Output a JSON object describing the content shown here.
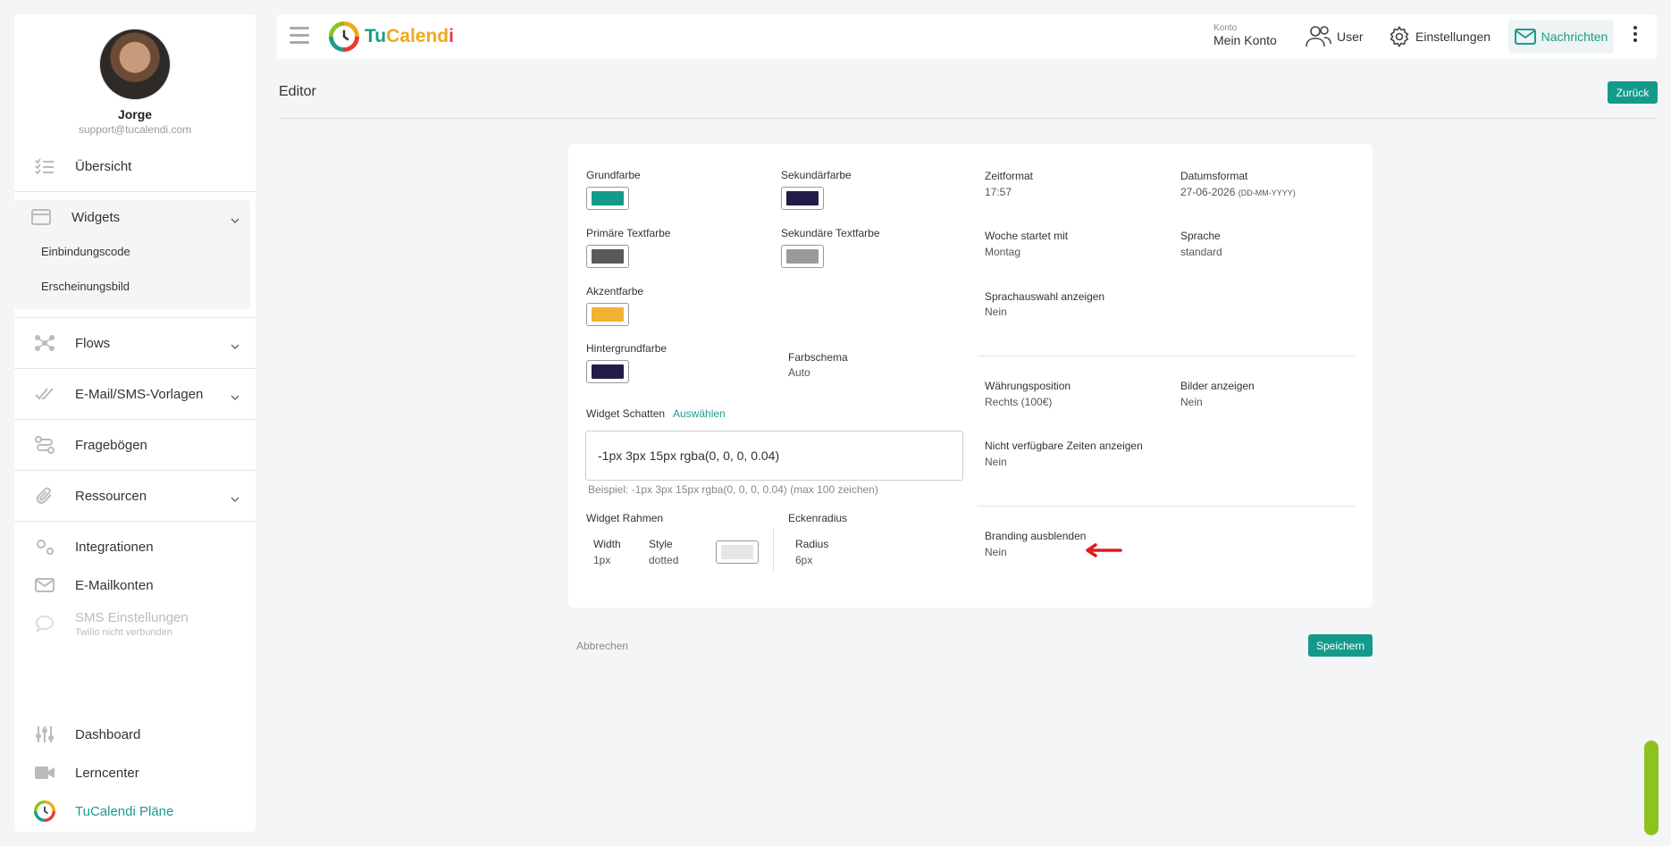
{
  "profile": {
    "name": "Jorge",
    "email": "support@tucalendi.com"
  },
  "sidebar": {
    "overview": "Übersicht",
    "widgets": "Widgets",
    "widgets_sub": [
      "Einbindungscode",
      "Erscheinungsbild"
    ],
    "flows": "Flows",
    "templates": "E-Mail/SMS-Vorlagen",
    "forms": "Fragebögen",
    "resources": "Ressourcen",
    "integrations": "Integrationen",
    "mail_accounts": "E-Mailkonten",
    "sms": "SMS Einstellungen",
    "sms_sub": "Twilio nicht verbunden",
    "dashboard": "Dashboard",
    "learn": "Lerncenter",
    "plans": "TuCalendi Pläne"
  },
  "topbar": {
    "logo_a": "Tu",
    "logo_b": "Calend",
    "logo_c": "i",
    "konto_small": "Konto",
    "konto_big": "Mein Konto",
    "user": "User",
    "settings": "Einstellungen",
    "messages": "Nachrichten"
  },
  "page": {
    "title": "Editor",
    "back": "Zurück",
    "cancel": "Abbrechen",
    "save": "Speichern"
  },
  "colors": {
    "primary": {
      "label": "Grundfarbe",
      "value": "#149a8a"
    },
    "secondary": {
      "label": "Sekundärfarbe",
      "value": "#221c4a"
    },
    "text_primary": {
      "label": "Primäre Textfarbe",
      "value": "#5a5a5a"
    },
    "text_secondary": {
      "label": "Sekundäre Textfarbe",
      "value": "#9a9a9a"
    },
    "accent": {
      "label": "Akzentfarbe",
      "value": "#f2b133"
    },
    "background": {
      "label": "Hintergrundfarbe",
      "value": "#221c4a"
    },
    "border": {
      "value": "#e6e6e6"
    }
  },
  "scheme": {
    "label": "Farbschema",
    "value": "Auto"
  },
  "shadow": {
    "label": "Widget Schatten",
    "select": "Auswählen",
    "value": "-1px 3px 15px rgba(0, 0, 0, 0.04)",
    "hint": "Beispiel: -1px 3px 15px rgba(0, 0, 0, 0.04) (max 100 zeichen)"
  },
  "border": {
    "label": "Widget Rahmen",
    "width_label": "Width",
    "width_value": "1px",
    "style_label": "Style",
    "style_value": "dotted"
  },
  "radius": {
    "label": "Eckenradius",
    "radius_label": "Radius",
    "radius_value": "6px"
  },
  "settings": {
    "time_format": {
      "label": "Zeitformat",
      "value": "17:57"
    },
    "date_format": {
      "label": "Datumsformat",
      "value": "27-06-2026",
      "hint": "(DD-MM-YYYY)"
    },
    "week_start": {
      "label": "Woche startet mit",
      "value": "Montag"
    },
    "language": {
      "label": "Sprache",
      "value": "standard"
    },
    "lang_select": {
      "label": "Sprachauswahl anzeigen",
      "value": "Nein"
    },
    "currency_pos": {
      "label": "Währungsposition",
      "value": "Rechts (100€)"
    },
    "show_images": {
      "label": "Bilder anzeigen",
      "value": "Nein"
    },
    "unavailable": {
      "label": "Nicht verfügbare Zeiten anzeigen",
      "value": "Nein"
    },
    "branding": {
      "label": "Branding ausblenden",
      "value": "Nein"
    }
  }
}
